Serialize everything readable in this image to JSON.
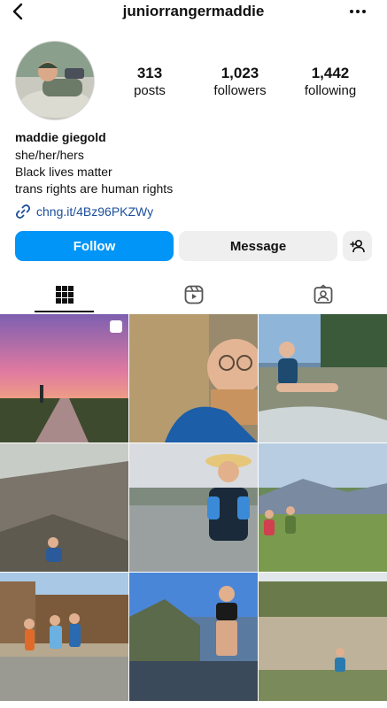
{
  "profile": {
    "username": "juniorrangermaddie",
    "display_name": "maddie giegold",
    "bio_lines": [
      "she/her/hers",
      "Black lives matter",
      "trans rights are human rights"
    ],
    "link": "chng.it/4Bz96PKZWy"
  },
  "stats": {
    "posts": {
      "value": "313",
      "label": "posts"
    },
    "followers": {
      "value": "1,023",
      "label": "followers"
    },
    "following": {
      "value": "1,442",
      "label": "following"
    }
  },
  "actions": {
    "follow": "Follow",
    "message": "Message"
  },
  "tabs": [
    {
      "icon": "grid-icon",
      "active": true
    },
    {
      "icon": "reels-icon",
      "active": false
    },
    {
      "icon": "tagged-icon",
      "active": false
    }
  ],
  "colors": {
    "accent": "#0095f6",
    "link": "#1c4f9c",
    "button_bg": "#efefef"
  },
  "posts": [
    {
      "description": "pink sunset over dirt road",
      "multi": true
    },
    {
      "description": "smiling man with glasses and beard, rock",
      "multi": false
    },
    {
      "description": "woman sitting by river",
      "multi": false
    },
    {
      "description": "rocky slope hiker",
      "multi": false
    },
    {
      "description": "hiker with hat and running vest",
      "multi": false
    },
    {
      "description": "two hikers in mountain meadow",
      "multi": false
    },
    {
      "description": "three women in front of lodge",
      "multi": false
    },
    {
      "description": "woman by river in canyon",
      "multi": false
    },
    {
      "description": "hikers by waterfall rocks",
      "multi": false
    }
  ]
}
